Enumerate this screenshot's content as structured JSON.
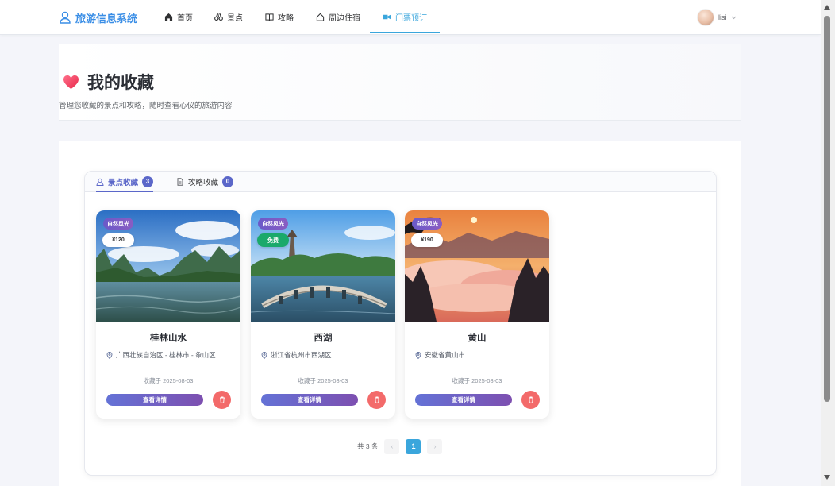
{
  "nav": {
    "brand": "旅游信息系统",
    "items": [
      {
        "label": "首页",
        "icon": "home-icon"
      },
      {
        "label": "景点",
        "icon": "binoculars-icon"
      },
      {
        "label": "攻略",
        "icon": "book-icon"
      },
      {
        "label": "周边住宿",
        "icon": "house-icon"
      },
      {
        "label": "门票预订",
        "icon": "ticket-icon",
        "active": true
      }
    ],
    "user": {
      "name": "lisi"
    }
  },
  "page": {
    "title": "我的收藏",
    "subtitle": "管理您收藏的景点和攻略，随时查看心仪的旅游内容"
  },
  "tabs": [
    {
      "label": "景点收藏",
      "count": "3",
      "active": true
    },
    {
      "label": "攻略收藏",
      "count": "0",
      "active": false
    }
  ],
  "cards": [
    {
      "category": "自然风光",
      "price": "¥120",
      "free": false,
      "name": "桂林山水",
      "location": "广西壮族自治区 - 桂林市 - 象山区",
      "saved": "收藏于 2025-08-03",
      "detail": "查看详情"
    },
    {
      "category": "自然风光",
      "price": "免费",
      "free": true,
      "name": "西湖",
      "location": "浙江省杭州市西湖区",
      "saved": "收藏于 2025-08-03",
      "detail": "查看详情"
    },
    {
      "category": "自然风光",
      "price": "¥190",
      "free": false,
      "name": "黄山",
      "location": "安徽省黄山市",
      "saved": "收藏于 2025-08-03",
      "detail": "查看详情"
    }
  ],
  "pagination": {
    "total": "共 3 条",
    "current": "1"
  },
  "colors": {
    "accent": "#3aa6dc",
    "tab_accent": "#5b67c9",
    "delete": "#f36a6a"
  }
}
